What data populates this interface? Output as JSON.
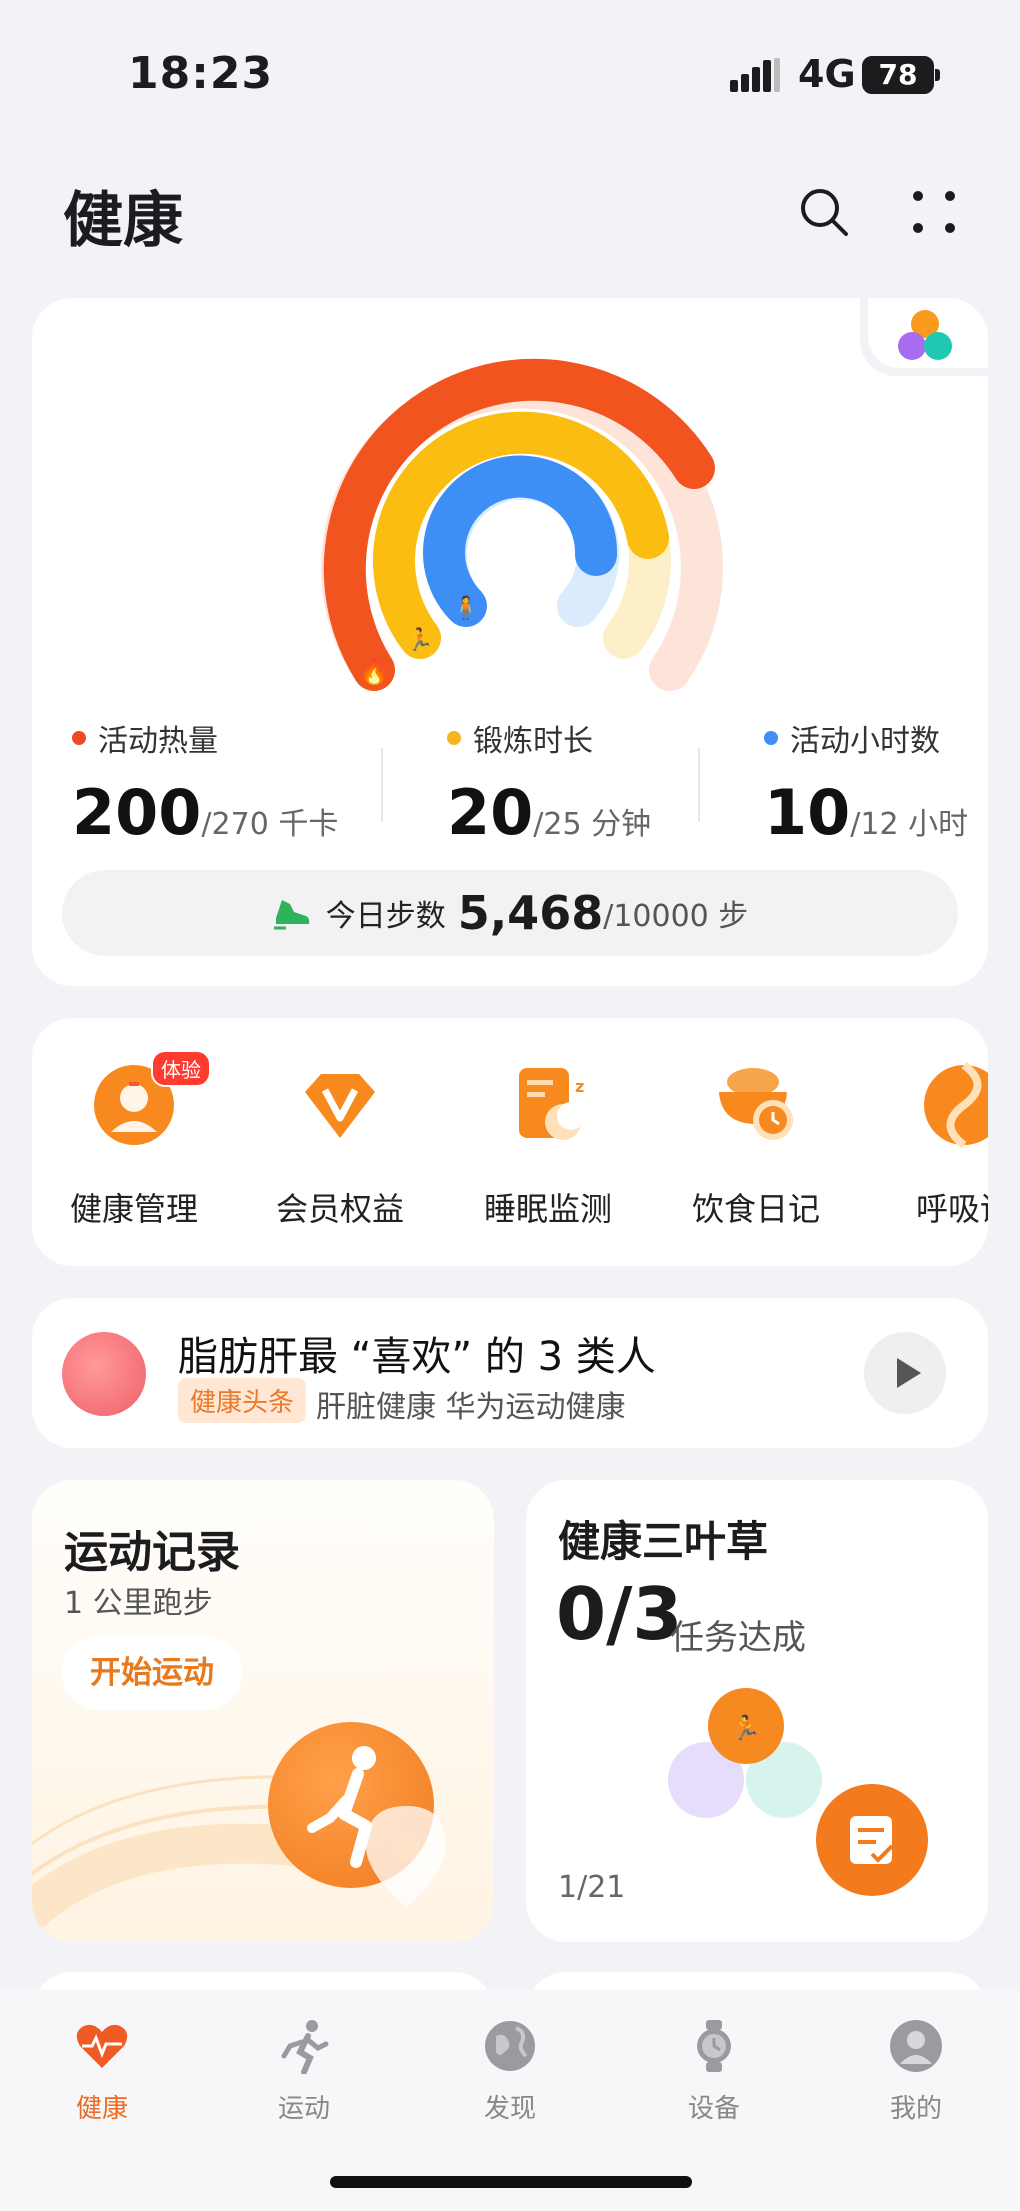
{
  "status_bar": {
    "time": "18:23",
    "network": "4G",
    "battery": "78"
  },
  "header": {
    "title": "健康"
  },
  "activity": {
    "metrics": [
      {
        "label": "活动热量",
        "value": "200",
        "goal": "/270 千卡",
        "color": "#f04a22"
      },
      {
        "label": "锻炼时长",
        "value": "20",
        "goal": "/25 分钟",
        "color": "#f6b51e"
      },
      {
        "label": "活动小时数",
        "value": "10",
        "goal": "/12 小时",
        "color": "#3f8ef4"
      }
    ],
    "steps": {
      "label": "今日步数",
      "value": "5,468",
      "goal": "/10000 步"
    }
  },
  "services": [
    {
      "name": "健康管理",
      "badge": "体验",
      "icon": "health-management-icon"
    },
    {
      "name": "会员权益",
      "badge": "",
      "icon": "vip-icon"
    },
    {
      "name": "睡眠监测",
      "badge": "",
      "icon": "sleep-icon"
    },
    {
      "name": "饮食日记",
      "badge": "",
      "icon": "diet-icon"
    },
    {
      "name": "呼吸训",
      "badge": "",
      "icon": "breathing-icon"
    }
  ],
  "news": {
    "title": "脂肪肝最 “喜欢” 的 3 类人",
    "tag": "健康头条",
    "source": "肝脏健康  华为运动健康"
  },
  "sport_record": {
    "title": "运动记录",
    "subtitle": "1 公里跑步",
    "button": "开始运动"
  },
  "clover": {
    "title": "健康三叶草",
    "progress": "0/3",
    "label": "任务达成",
    "page": "1/21"
  },
  "tabs": [
    {
      "label": "健康",
      "icon": "heart-pulse-icon",
      "active": true
    },
    {
      "label": "运动",
      "icon": "runner-icon",
      "active": false
    },
    {
      "label": "发现",
      "icon": "globe-icon",
      "active": false
    },
    {
      "label": "设备",
      "icon": "watch-icon",
      "active": false
    },
    {
      "label": "我的",
      "icon": "profile-icon",
      "active": false
    }
  ]
}
